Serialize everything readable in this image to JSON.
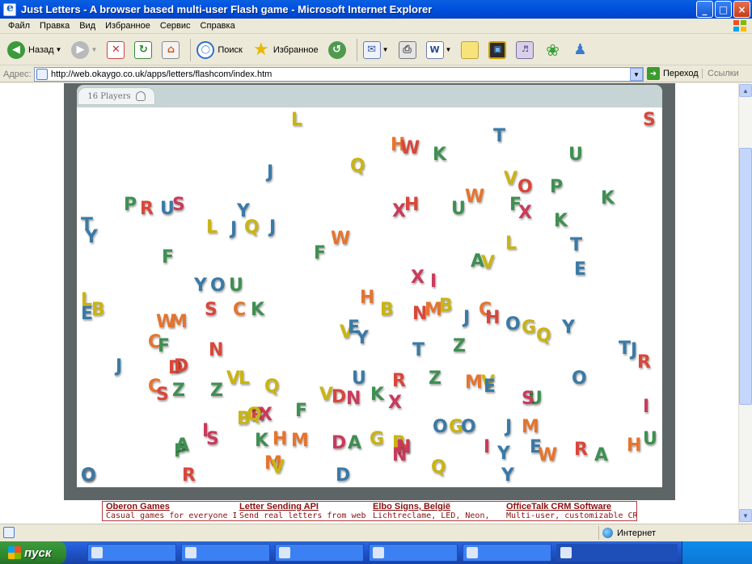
{
  "window": {
    "title": "Just Letters - A browser based multi-user Flash game - Microsoft Internet Explorer",
    "buttons": {
      "minimize": "_",
      "maximize": "□",
      "close": "×"
    }
  },
  "menu": [
    "Файл",
    "Правка",
    "Вид",
    "Избранное",
    "Сервис",
    "Справка"
  ],
  "toolbar": {
    "back_label": "Назад",
    "search_label": "Поиск",
    "favorites_label": "Избранное"
  },
  "address": {
    "label": "Адрес:",
    "url": "http://web.okaygo.co.uk/apps/letters/flashcom/index.htm",
    "go_label": "Переход",
    "links_label": "Ссылки"
  },
  "game": {
    "players_label": "16 Players",
    "colors": {
      "green": "#3f8f52",
      "red": "#d8473a",
      "blue": "#3a7aa6",
      "yellow": "#c9b413",
      "orange": "#e5742e",
      "pink": "#c93b5b"
    },
    "letters": [
      {
        "ch": "L",
        "c": "yellow"
      },
      {
        "ch": "S",
        "c": "red"
      },
      {
        "ch": "T",
        "c": "blue"
      },
      {
        "ch": "H",
        "c": "orange"
      },
      {
        "ch": "W",
        "c": "red"
      },
      {
        "ch": "K",
        "c": "green"
      },
      {
        "ch": "U",
        "c": "green"
      },
      {
        "ch": "J",
        "c": "blue"
      },
      {
        "ch": "Q",
        "c": "yellow"
      },
      {
        "ch": "V",
        "c": "yellow"
      },
      {
        "ch": "O",
        "c": "red"
      },
      {
        "ch": "P",
        "c": "green"
      },
      {
        "ch": "K",
        "c": "green"
      },
      {
        "ch": "P",
        "c": "green"
      },
      {
        "ch": "R",
        "c": "red"
      },
      {
        "ch": "U",
        "c": "blue"
      },
      {
        "ch": "S",
        "c": "pink"
      },
      {
        "ch": "X",
        "c": "pink"
      },
      {
        "ch": "F",
        "c": "green"
      },
      {
        "ch": "Y",
        "c": "blue"
      },
      {
        "ch": "H",
        "c": "red"
      },
      {
        "ch": "U",
        "c": "green"
      },
      {
        "ch": "W",
        "c": "orange"
      },
      {
        "ch": "X",
        "c": "pink"
      },
      {
        "ch": "K",
        "c": "green"
      },
      {
        "ch": "T",
        "c": "blue"
      },
      {
        "ch": "L",
        "c": "yellow"
      },
      {
        "ch": "J",
        "c": "blue"
      },
      {
        "ch": "Q",
        "c": "yellow"
      },
      {
        "ch": "J",
        "c": "blue"
      },
      {
        "ch": "W",
        "c": "orange"
      },
      {
        "ch": "Y",
        "c": "blue"
      },
      {
        "ch": "F",
        "c": "green"
      },
      {
        "ch": "F",
        "c": "green"
      },
      {
        "ch": "L",
        "c": "yellow"
      },
      {
        "ch": "T",
        "c": "blue"
      },
      {
        "ch": "A",
        "c": "green"
      },
      {
        "ch": "V",
        "c": "yellow"
      },
      {
        "ch": "E",
        "c": "blue"
      },
      {
        "ch": "X",
        "c": "pink"
      },
      {
        "ch": "Y",
        "c": "blue"
      },
      {
        "ch": "O",
        "c": "blue"
      },
      {
        "ch": "U",
        "c": "green"
      },
      {
        "ch": "L",
        "c": "yellow"
      },
      {
        "ch": "E",
        "c": "blue"
      },
      {
        "ch": "B",
        "c": "yellow"
      },
      {
        "ch": "H",
        "c": "orange"
      },
      {
        "ch": "S",
        "c": "red"
      },
      {
        "ch": "C",
        "c": "orange"
      },
      {
        "ch": "K",
        "c": "green"
      },
      {
        "ch": "B",
        "c": "yellow"
      },
      {
        "ch": "N",
        "c": "red"
      },
      {
        "ch": "M",
        "c": "orange"
      },
      {
        "ch": "B",
        "c": "yellow"
      },
      {
        "ch": "J",
        "c": "blue"
      },
      {
        "ch": "C",
        "c": "orange"
      },
      {
        "ch": "H",
        "c": "red"
      },
      {
        "ch": "W",
        "c": "orange"
      },
      {
        "ch": "M",
        "c": "orange"
      },
      {
        "ch": "I",
        "c": "pink"
      },
      {
        "ch": "V",
        "c": "yellow"
      },
      {
        "ch": "E",
        "c": "blue"
      },
      {
        "ch": "Y",
        "c": "blue"
      },
      {
        "ch": "O",
        "c": "blue"
      },
      {
        "ch": "G",
        "c": "yellow"
      },
      {
        "ch": "Q",
        "c": "yellow"
      },
      {
        "ch": "Y",
        "c": "blue"
      },
      {
        "ch": "C",
        "c": "orange"
      },
      {
        "ch": "F",
        "c": "green"
      },
      {
        "ch": "N",
        "c": "red"
      },
      {
        "ch": "T",
        "c": "blue"
      },
      {
        "ch": "Z",
        "c": "green"
      },
      {
        "ch": "D",
        "c": "red"
      },
      {
        "ch": "J",
        "c": "blue"
      },
      {
        "ch": "T",
        "c": "blue"
      },
      {
        "ch": "J",
        "c": "blue"
      },
      {
        "ch": "D",
        "c": "red"
      },
      {
        "ch": "R",
        "c": "red"
      },
      {
        "ch": "C",
        "c": "orange"
      },
      {
        "ch": "S",
        "c": "red"
      },
      {
        "ch": "Z",
        "c": "green"
      },
      {
        "ch": "Z",
        "c": "green"
      },
      {
        "ch": "V",
        "c": "yellow"
      },
      {
        "ch": "L",
        "c": "yellow"
      },
      {
        "ch": "Q",
        "c": "yellow"
      },
      {
        "ch": "U",
        "c": "blue"
      },
      {
        "ch": "R",
        "c": "red"
      },
      {
        "ch": "Z",
        "c": "green"
      },
      {
        "ch": "M",
        "c": "orange"
      },
      {
        "ch": "V",
        "c": "yellow"
      },
      {
        "ch": "E",
        "c": "blue"
      },
      {
        "ch": "O",
        "c": "blue"
      },
      {
        "ch": "V",
        "c": "yellow"
      },
      {
        "ch": "D",
        "c": "red"
      },
      {
        "ch": "N",
        "c": "pink"
      },
      {
        "ch": "K",
        "c": "green"
      },
      {
        "ch": "X",
        "c": "pink"
      },
      {
        "ch": "R",
        "c": "red"
      },
      {
        "ch": "U",
        "c": "green"
      },
      {
        "ch": "F",
        "c": "green"
      },
      {
        "ch": "B",
        "c": "yellow"
      },
      {
        "ch": "Q",
        "c": "yellow"
      },
      {
        "ch": "X",
        "c": "pink"
      },
      {
        "ch": "S",
        "c": "pink"
      },
      {
        "ch": "O",
        "c": "blue"
      },
      {
        "ch": "G",
        "c": "yellow"
      },
      {
        "ch": "O",
        "c": "blue"
      },
      {
        "ch": "J",
        "c": "blue"
      },
      {
        "ch": "M",
        "c": "orange"
      },
      {
        "ch": "I",
        "c": "pink"
      },
      {
        "ch": "S",
        "c": "pink"
      },
      {
        "ch": "P",
        "c": "green"
      },
      {
        "ch": "K",
        "c": "green"
      },
      {
        "ch": "H",
        "c": "orange"
      },
      {
        "ch": "M",
        "c": "orange"
      },
      {
        "ch": "D",
        "c": "pink"
      },
      {
        "ch": "A",
        "c": "green"
      },
      {
        "ch": "G",
        "c": "yellow"
      },
      {
        "ch": "B",
        "c": "yellow"
      },
      {
        "ch": "H",
        "c": "orange"
      },
      {
        "ch": "N",
        "c": "pink"
      },
      {
        "ch": "A",
        "c": "green"
      },
      {
        "ch": "M",
        "c": "orange"
      },
      {
        "ch": "N",
        "c": "pink"
      },
      {
        "ch": "E",
        "c": "blue"
      },
      {
        "ch": "I",
        "c": "pink"
      },
      {
        "ch": "Y",
        "c": "blue"
      },
      {
        "ch": "W",
        "c": "orange"
      },
      {
        "ch": "R",
        "c": "red"
      },
      {
        "ch": "A",
        "c": "green"
      },
      {
        "ch": "H",
        "c": "orange"
      },
      {
        "ch": "R",
        "c": "red"
      },
      {
        "ch": "V",
        "c": "yellow"
      },
      {
        "ch": "Q",
        "c": "yellow"
      },
      {
        "ch": "O",
        "c": "red"
      },
      {
        "ch": "D",
        "c": "blue"
      },
      {
        "ch": "Y",
        "c": "blue"
      },
      {
        "ch": "O",
        "c": "blue"
      },
      {
        "ch": "U",
        "c": "green"
      },
      {
        "ch": "I",
        "c": "pink"
      }
    ]
  },
  "ads": [
    {
      "title": "Oberon Games",
      "text": "Casual games for everyone It's"
    },
    {
      "title": "Letter Sending API",
      "text": "Send real letters from web"
    },
    {
      "title": "Elbo Signs, België",
      "text": "Lichtreclame, LED, Neon,"
    },
    {
      "title": "OfficeTalk CRM Software",
      "text": "Multi-user, customizable CRM."
    }
  ],
  "status": {
    "zone": "Интернет"
  },
  "taskbar": {
    "start_label": "пуск"
  }
}
